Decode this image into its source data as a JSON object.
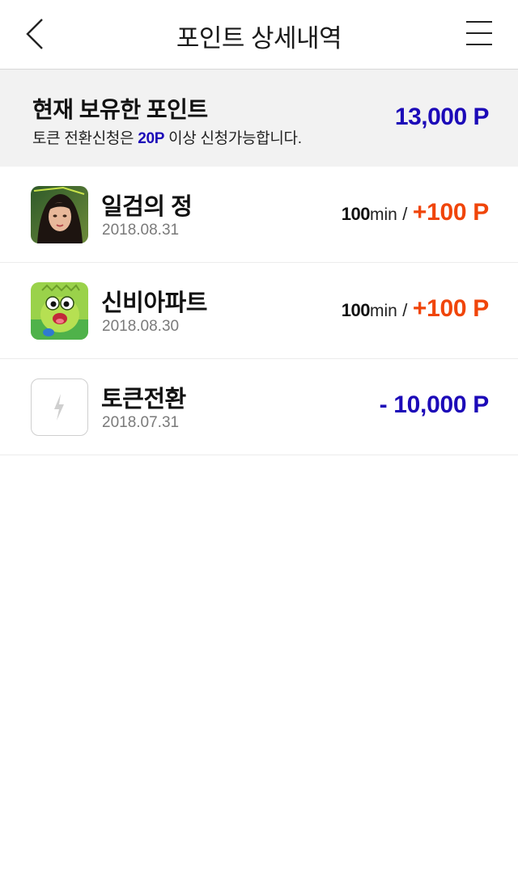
{
  "header": {
    "title": "포인트 상세내역",
    "back_icon": "chevron-left-icon",
    "menu_icon": "hamburger-menu-icon"
  },
  "summary": {
    "title": "현재 보유한 포인트",
    "note_prefix": "토큰 전환신청은 ",
    "note_highlight": "20P",
    "note_suffix": " 이상 신청가능합니다.",
    "points": "13,000 P"
  },
  "history": [
    {
      "name": "일검의 정",
      "date": "2018.08.31",
      "duration_value": "100",
      "duration_unit": "min",
      "separator": "/",
      "points": "+100 P",
      "icon": "game-thumbnail-woman-icon"
    },
    {
      "name": "신비아파트",
      "date": "2018.08.30",
      "duration_value": "100",
      "duration_unit": "min",
      "separator": "/",
      "points": "+100 P",
      "icon": "game-thumbnail-goblin-icon"
    },
    {
      "name": "토큰전환",
      "date": "2018.07.31",
      "points": "- 10,000 P",
      "icon": "lightning-bolt-icon"
    }
  ],
  "colors": {
    "accent_blue": "#1c0ab8",
    "accent_orange": "#f0450a",
    "summary_bg": "#f2f2f2"
  }
}
